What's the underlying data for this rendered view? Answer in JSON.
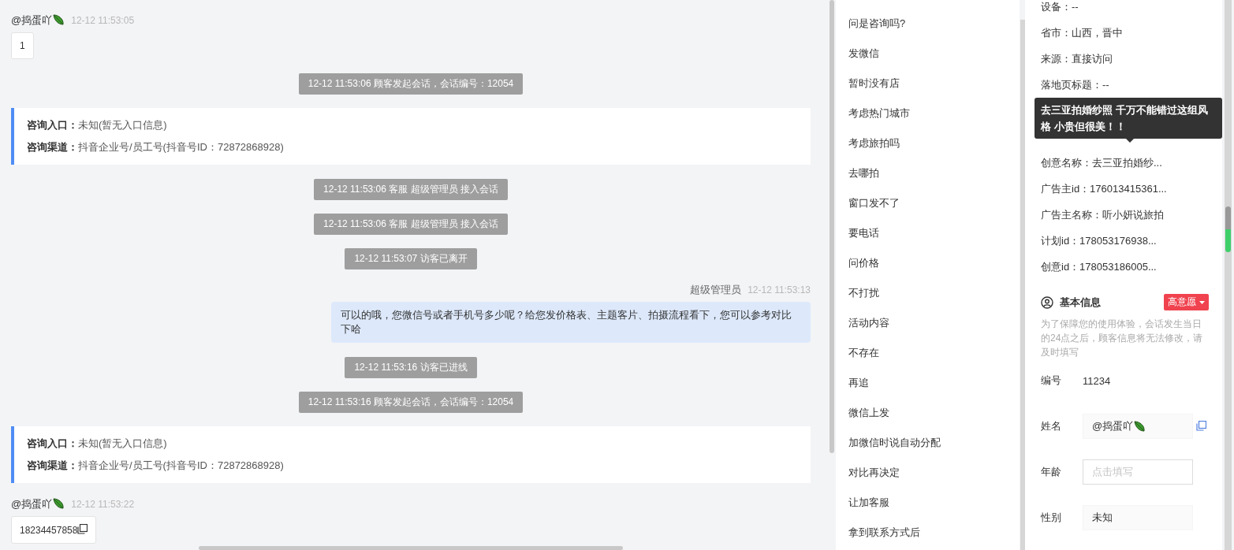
{
  "chat": {
    "messages": [
      {
        "kind": "visitor",
        "sender": "@捣蛋吖",
        "time": "12-12 11:53:05",
        "text": "1",
        "copyable": false
      },
      {
        "kind": "system",
        "text": "12-12 11:53:06 顾客发起会话，会话编号：12054"
      },
      {
        "kind": "source",
        "fields": [
          {
            "label": "咨询入口：",
            "value": "未知(暂无入口信息)"
          },
          {
            "label": "咨询渠道：",
            "value": "抖音企业号/员工号(抖音号ID：72872868928)"
          }
        ]
      },
      {
        "kind": "system",
        "text": "12-12 11:53:06 客服 超级管理员 接入会话"
      },
      {
        "kind": "system",
        "text": "12-12 11:53:06 客服 超级管理员 接入会话"
      },
      {
        "kind": "system",
        "text": "12-12 11:53:07 访客已离开"
      },
      {
        "kind": "agent",
        "sender": "超级管理员",
        "time": "12-12 11:53:13",
        "text": "可以的哦，您微信号或者手机号多少呢？给您发价格表、主题客片、拍摄流程看下，您可以参考对比下哈"
      },
      {
        "kind": "system",
        "text": "12-12 11:53:16 访客已进线"
      },
      {
        "kind": "system",
        "text": "12-12 11:53:16 顾客发起会话，会话编号：12054"
      },
      {
        "kind": "source",
        "fields": [
          {
            "label": "咨询入口：",
            "value": "未知(暂无入口信息)"
          },
          {
            "label": "咨询渠道：",
            "value": "抖音企业号/员工号(抖音号ID：72872868928)"
          }
        ]
      },
      {
        "kind": "visitor",
        "sender": "@捣蛋吖",
        "time": "12-12 11:53:22",
        "text": "18234457858",
        "copyable": true
      }
    ]
  },
  "quick_replies": [
    "问是咨询吗?",
    "发微信",
    "暂时没有店",
    "考虑热门城市",
    "考虑旅拍吗",
    "去哪拍",
    "窗口发不了",
    "要电话",
    "问价格",
    "不打扰",
    "活动内容",
    "不存在",
    "再追",
    "微信上发",
    "加微信时说自动分配",
    "对比再决定",
    "让加客服",
    "拿到联系方式后"
  ],
  "visitor_info": {
    "rows_above": [
      "设备：--",
      "省市：山西，晋中",
      "来源：直接访问",
      "落地页标题：--"
    ],
    "tooltip": "去三亚拍婚纱照 千万不能错过这组风格 小贵但很美！！",
    "rows_below": [
      "创意名称：去三亚拍婚纱...",
      "广告主id：176013415361...",
      "广告主名称：听小妍说旅拍",
      "计划id：178053176938...",
      "创意id：178053186005..."
    ]
  },
  "basic_info": {
    "title": "基本信息",
    "intent_tag": "高意愿",
    "notice": "为了保障您的使用体验，会话发生当日的24点之后，顾客信息将无法修改，请及时填写",
    "fields": [
      {
        "kind": "text",
        "label": "编号",
        "value": "11234"
      },
      {
        "kind": "input",
        "label": "姓名",
        "value": "@捣蛋吖",
        "copyable": true
      },
      {
        "kind": "input",
        "label": "年龄",
        "placeholder": "点击填写",
        "copyable": false
      },
      {
        "kind": "input",
        "label": "性别",
        "value": "未知",
        "copyable": false
      }
    ]
  }
}
